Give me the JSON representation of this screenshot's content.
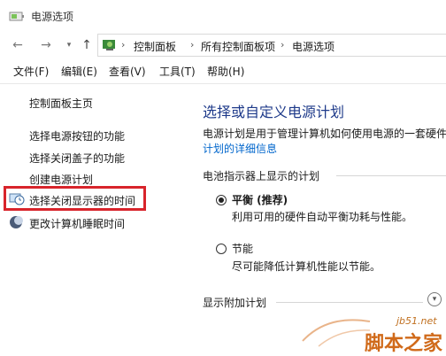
{
  "window": {
    "title": "电源选项",
    "title_icon": "power-options-icon"
  },
  "address_bar": {
    "breadcrumbs": [
      "控制面板",
      "所有控制面板项",
      "电源选项"
    ],
    "icons": [
      "back-arrow-icon",
      "forward-arrow-icon",
      "recent-dropdown-icon",
      "up-arrow-icon",
      "control-panel-icon"
    ]
  },
  "menu": {
    "items": [
      "文件(F)",
      "编辑(E)",
      "查看(V)",
      "工具(T)",
      "帮助(H)"
    ]
  },
  "sidebar": {
    "home": "控制面板主页",
    "links": [
      "选择电源按钮的功能",
      "选择关闭盖子的功能",
      "创建电源计划",
      "选择关闭显示器的时间",
      "更改计算机睡眠时间"
    ],
    "highlight_color": "#d8242b"
  },
  "main": {
    "title": "选择或自定义电源计划",
    "description": "电源计划是用于管理计算机如何使用电源的一套硬件",
    "details_link": "计划的详细信息",
    "battery_section": "电池指示器上显示的计划",
    "plans": [
      {
        "name": "平衡 (推荐)",
        "description": "利用可用的硬件自动平衡功耗与性能。",
        "selected": true
      },
      {
        "name": "节能",
        "description": "尽可能降低计算机性能以节能。",
        "selected": false
      }
    ],
    "additional_section": "显示附加计划"
  },
  "watermark": {
    "url": "jb51.net",
    "text": "脚本之家"
  },
  "colors": {
    "title_blue": "#1e3a8a",
    "link_blue": "#0066cc",
    "watermark_orange": "#d06a1a"
  }
}
